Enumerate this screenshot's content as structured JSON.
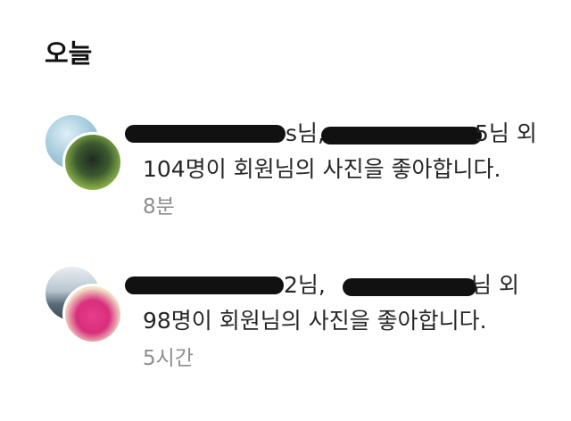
{
  "section": {
    "title": "오늘"
  },
  "notifications": [
    {
      "name1_suffix": "s님,",
      "name2_suffix": "5님 외",
      "line2": "104명이 회원님의 사진을 좋아합니다.",
      "time": "8분"
    },
    {
      "name1_suffix": "2님,",
      "name2_suffix": "님 외",
      "line2": "98명이 회원님의 사진을 좋아합니다.",
      "time": "5시간"
    }
  ]
}
